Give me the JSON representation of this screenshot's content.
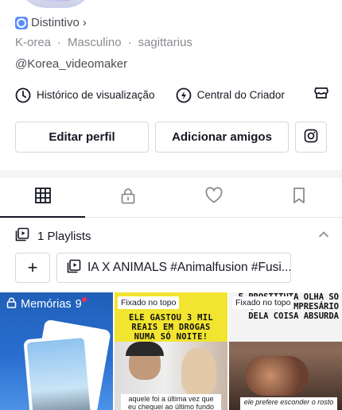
{
  "profile": {
    "badge_label": "Distintivo",
    "badge_chevron": "›",
    "meta": [
      "K-orea",
      "Masculino",
      "sagittarius"
    ],
    "meta_separator": "·",
    "handle": "@Korea_videomaker"
  },
  "links": {
    "history_label": "Histórico de visualização",
    "creator_label": "Central do Criador"
  },
  "actions": {
    "edit_label": "Editar perfil",
    "add_friends_label": "Adicionar amigos"
  },
  "tabs": [
    {
      "name": "grid-icon",
      "active": true
    },
    {
      "name": "lock-icon",
      "active": false
    },
    {
      "name": "heart-icon",
      "active": false
    },
    {
      "name": "bookmark-icon",
      "active": false
    }
  ],
  "playlists": {
    "header_label": "1 Playlists",
    "add_symbol": "+",
    "items": [
      {
        "title": "IA X ANIMALS #Animalfusion #Fusi..."
      }
    ]
  },
  "grid": {
    "memories": {
      "label": "Memórias",
      "count": "9"
    },
    "videos": [
      {
        "pinned_label": "Fixado no topo",
        "headline": "ELE GASTOU 3 MIL REAIS EM DROGAS NUMA SÓ NOITE!",
        "caption": "aquele foi a última vez que eu cheguei ao último fundo do poço"
      },
      {
        "pinned_label": "Fixado no topo",
        "headline": "E PROSTITUTA OLHA SÓ QUE E O EMPRESÁRIO DELA COISA ABSURDA",
        "caption": "ele prefere esconder o rosto"
      }
    ]
  },
  "colors": {
    "accent_red": "#fe2c55",
    "badge_blue": "#5b8cff",
    "memories_blue": "#2a6fd0",
    "thumb_yellow": "#f2e530"
  }
}
